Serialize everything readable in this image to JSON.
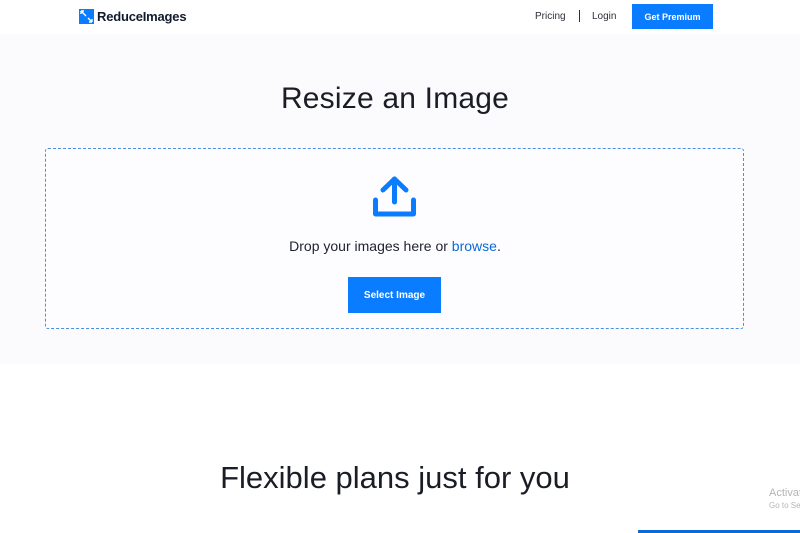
{
  "brand": {
    "name": "ReduceImages",
    "logo_icon": "reduce-images-logo-icon",
    "accent_color": "#0a7cff"
  },
  "nav": {
    "pricing": "Pricing",
    "login": "Login",
    "premium_button": "Get Premium"
  },
  "hero": {
    "title": "Resize an Image",
    "upload_icon": "upload-icon",
    "drop_text": "Drop your images here or ",
    "browse_link": "browse",
    "drop_suffix": ".",
    "select_button": "Select Image"
  },
  "plans": {
    "title": "Flexible plans just for you"
  },
  "overlay": {
    "activate_title": "Activate",
    "activate_sub": "Go to Se"
  }
}
